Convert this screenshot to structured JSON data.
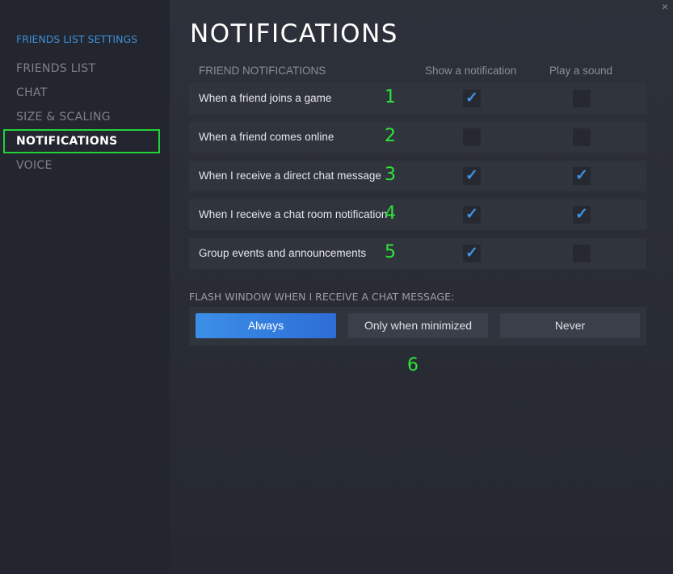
{
  "sidebar": {
    "heading": "FRIENDS LIST SETTINGS",
    "items": [
      {
        "label": "FRIENDS LIST"
      },
      {
        "label": "CHAT"
      },
      {
        "label": "SIZE & SCALING"
      },
      {
        "label": "NOTIFICATIONS",
        "active": true
      },
      {
        "label": "VOICE"
      }
    ]
  },
  "main": {
    "title": "NOTIFICATIONS",
    "close": "×",
    "section": "FRIEND NOTIFICATIONS",
    "col_show": "Show a notification",
    "col_sound": "Play a sound",
    "rows": [
      {
        "label": "When a friend joins a game",
        "annotation": "1",
        "show": true,
        "sound": false
      },
      {
        "label": "When a friend comes online",
        "annotation": "2",
        "show": false,
        "sound": false
      },
      {
        "label": "When I receive a direct chat message",
        "annotation": "3",
        "show": true,
        "sound": true
      },
      {
        "label": "When I receive a chat room notification",
        "annotation": "4",
        "show": true,
        "sound": true
      },
      {
        "label": "Group events and announcements",
        "annotation": "5",
        "show": true,
        "sound": false
      }
    ],
    "flash": {
      "label": "FLASH WINDOW WHEN I RECEIVE A CHAT MESSAGE:",
      "options": [
        "Always",
        "Only when minimized",
        "Never"
      ],
      "selected": "Always",
      "annotation": "6"
    },
    "check_glyph": "✓"
  },
  "colors": {
    "accent": "#3d94e6",
    "annotation": "#2ee63a"
  }
}
